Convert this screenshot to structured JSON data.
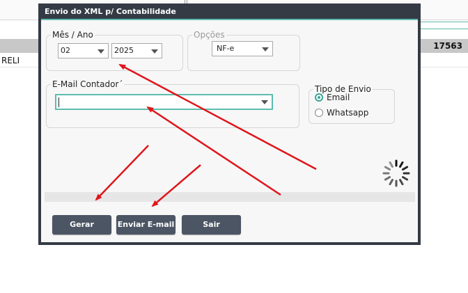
{
  "background": {
    "row_number": "17563",
    "row_text": "RELI"
  },
  "dialog": {
    "title": "Envio do XML p/ Contabilidade",
    "mes_ano": {
      "legend": "Mês / Ano",
      "month": "02",
      "year": "2025"
    },
    "opcoes": {
      "legend": "Opções",
      "value": "NF-e"
    },
    "email": {
      "legend": "E-Mail Contador´",
      "value": ""
    },
    "tipo_envio": {
      "legend": "Tipo de Envio",
      "options": [
        "Email",
        "Whatsapp"
      ],
      "selected": "Email"
    },
    "buttons": {
      "gerar": "Gerar",
      "enviar_email": "Enviar E-mail",
      "sair": "Sair"
    }
  },
  "colors": {
    "accent": "#5dbcae",
    "title_bar": "#343b45",
    "button": "#4b5563",
    "annotation_arrow": "#e0151a"
  }
}
